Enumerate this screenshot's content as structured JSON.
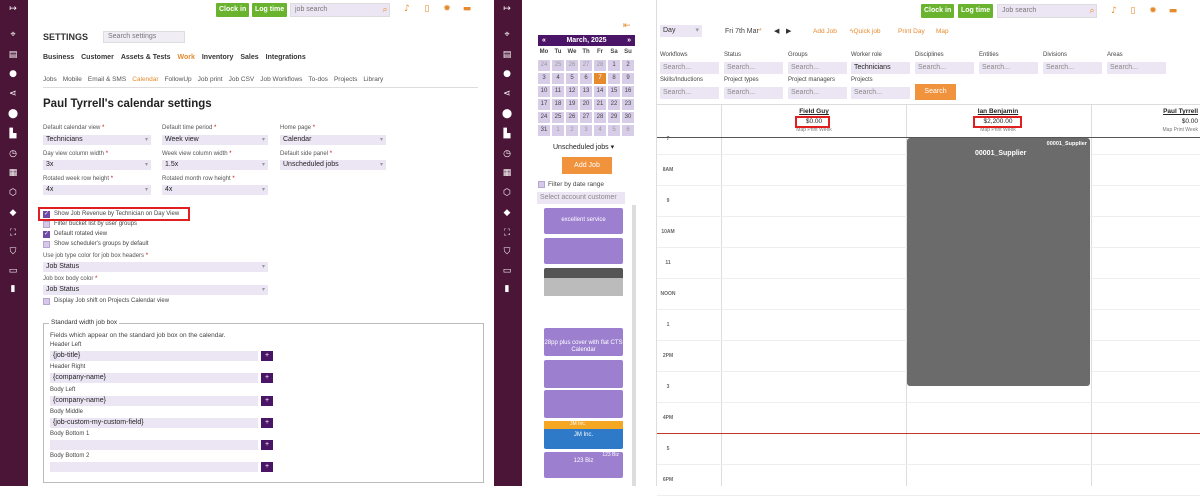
{
  "left": {
    "topbar": {
      "clock_in": "Clock in",
      "log_time": "Log time",
      "search_placeholder": "job search"
    },
    "title": "SETTINGS",
    "settings_search_placeholder": "Search settings",
    "main_tabs": [
      "Business",
      "Customer",
      "Assets & Tests",
      "Work",
      "Inventory",
      "Sales",
      "Integrations"
    ],
    "active_main_tab": "Work",
    "sub_tabs": [
      "Jobs",
      "Mobile",
      "Email & SMS",
      "Calendar",
      "FollowUp",
      "Job print",
      "Job CSV",
      "Job Workflows",
      "To-dos",
      "Projects",
      "Library"
    ],
    "active_sub_tab": "Calendar",
    "heading": "Paul Tyrrell's calendar settings",
    "fields": {
      "default_calendar_view": {
        "label": "Default calendar view",
        "value": "Technicians"
      },
      "default_time_period": {
        "label": "Default time period",
        "value": "Week view"
      },
      "home_page": {
        "label": "Home page",
        "value": "Calendar"
      },
      "day_view_column_width": {
        "label": "Day view column width",
        "value": "3x"
      },
      "week_view_column_width": {
        "label": "Week view column width",
        "value": "1.5x"
      },
      "default_side_panel": {
        "label": "Default side panel",
        "value": "Unscheduled jobs"
      },
      "rotated_week_row_height": {
        "label": "Rotated week row height",
        "value": "4x"
      },
      "rotated_month_row_height": {
        "label": "Rotated month row height",
        "value": "4x"
      }
    },
    "checkboxes": [
      {
        "label": "Show Job Revenue by Technician on Day View",
        "checked": true
      },
      {
        "label": "Filter bucket list by user groups",
        "checked": false
      },
      {
        "label": "Default rotated view",
        "checked": true
      },
      {
        "label": "Show scheduler's groups by default",
        "checked": false
      }
    ],
    "job_type_color": {
      "label": "Use job type color for job box headers",
      "value": "Job Status"
    },
    "job_box_body_color": {
      "label": "Job box body color",
      "value": "Job Status"
    },
    "display_shift": "Display Job shift on Projects Calendar view",
    "standard_box": {
      "legend": "Standard width job box",
      "description": "Fields which appear on the standard job box on the calendar.",
      "rows": [
        {
          "label": "Header Left",
          "value": "{job-title}"
        },
        {
          "label": "Header Right",
          "value": "{company-name}"
        },
        {
          "label": "Body Left",
          "value": "{company-name}"
        },
        {
          "label": "Body Middle",
          "value": "{job-custom-my-custom-field}"
        },
        {
          "label": "Body Bottom 1",
          "value": ""
        },
        {
          "label": "Body Bottom 2",
          "value": ""
        }
      ],
      "plus": "+"
    }
  },
  "right": {
    "calendar": {
      "month": "March, 2025",
      "prev": "«",
      "next": "»",
      "weekdays": [
        "Mo",
        "Tu",
        "We",
        "Th",
        "Fr",
        "Sa",
        "Su"
      ],
      "weeks": [
        [
          "24",
          "25",
          "26",
          "27",
          "28",
          "1",
          "2"
        ],
        [
          "3",
          "4",
          "5",
          "6",
          "7",
          "8",
          "9"
        ],
        [
          "10",
          "11",
          "12",
          "13",
          "14",
          "15",
          "16"
        ],
        [
          "17",
          "18",
          "19",
          "20",
          "21",
          "22",
          "23"
        ],
        [
          "24",
          "25",
          "26",
          "27",
          "28",
          "29",
          "30"
        ],
        [
          "31",
          "1",
          "2",
          "3",
          "4",
          "5",
          "6"
        ]
      ],
      "today": "7"
    },
    "collapse_icon": "⇤",
    "unscheduled": "Unscheduled jobs",
    "add_job": "Add Job",
    "filter_by_date": "Filter by date range",
    "select_account": "Select account customer",
    "jobs": [
      {
        "top": "excellent service",
        "main": "excellent service",
        "color": "#9c7fcf"
      },
      {
        "top": "",
        "main": "",
        "color": "#9c7fcf"
      },
      {
        "top": "",
        "main": "",
        "color": "#666666"
      },
      {
        "top": "",
        "main": "28pp plus cover with flat CTS Calendar",
        "color": "#9c7fcf"
      },
      {
        "top": "",
        "main": "",
        "color": "#9c7fcf"
      },
      {
        "top": "",
        "main": "",
        "color": "#9c7fcf"
      },
      {
        "top": "JM Inc.",
        "main": "JM Inc.",
        "color": "#2f79c9"
      },
      {
        "top": "123 Biz",
        "main": "123 Biz",
        "color": "#9c7fcf"
      }
    ],
    "toolbar": {
      "view": "Day",
      "date": "Fri 7th Mar",
      "add_job": "Add Job",
      "quick_job": "Quick job",
      "print_day": "Print Day",
      "map": "Map",
      "clock_in": "Clock in",
      "log_time": "Log time",
      "search_placeholder": "Job search"
    },
    "filters": {
      "row1": [
        {
          "label": "Workflows",
          "value": "Search..."
        },
        {
          "label": "Status",
          "value": "Search..."
        },
        {
          "label": "Groups",
          "value": "Search..."
        },
        {
          "label": "Worker role",
          "value": "Technicians"
        },
        {
          "label": "Disciplines",
          "value": "Search..."
        },
        {
          "label": "Entities",
          "value": "Search..."
        },
        {
          "label": "Divisions",
          "value": "Search..."
        },
        {
          "label": "Areas",
          "value": "Search..."
        }
      ],
      "row2": [
        {
          "label": "Skills/Inductions",
          "value": "Search..."
        },
        {
          "label": "Project types",
          "value": "Search..."
        },
        {
          "label": "Project managers",
          "value": "Search..."
        },
        {
          "label": "Projects",
          "value": "Search..."
        }
      ],
      "search_button": "Search"
    },
    "technicians": [
      {
        "name": "Field Guy",
        "revenue": "$0.00",
        "links": "Map Print Week"
      },
      {
        "name": "Ian Benjamin",
        "revenue": "$2,200.00",
        "links": "Map Print Week"
      },
      {
        "name": "Paul Tyrrell",
        "revenue": "$0.00",
        "links": "Map Print Week"
      }
    ],
    "times": [
      "7",
      "8AM",
      "9",
      "10AM",
      "11",
      "NOON",
      "1",
      "2PM",
      "3",
      "4PM",
      "5",
      "6PM"
    ],
    "event": {
      "header": "00001_Supplier",
      "body": "00001_Supplier"
    }
  }
}
